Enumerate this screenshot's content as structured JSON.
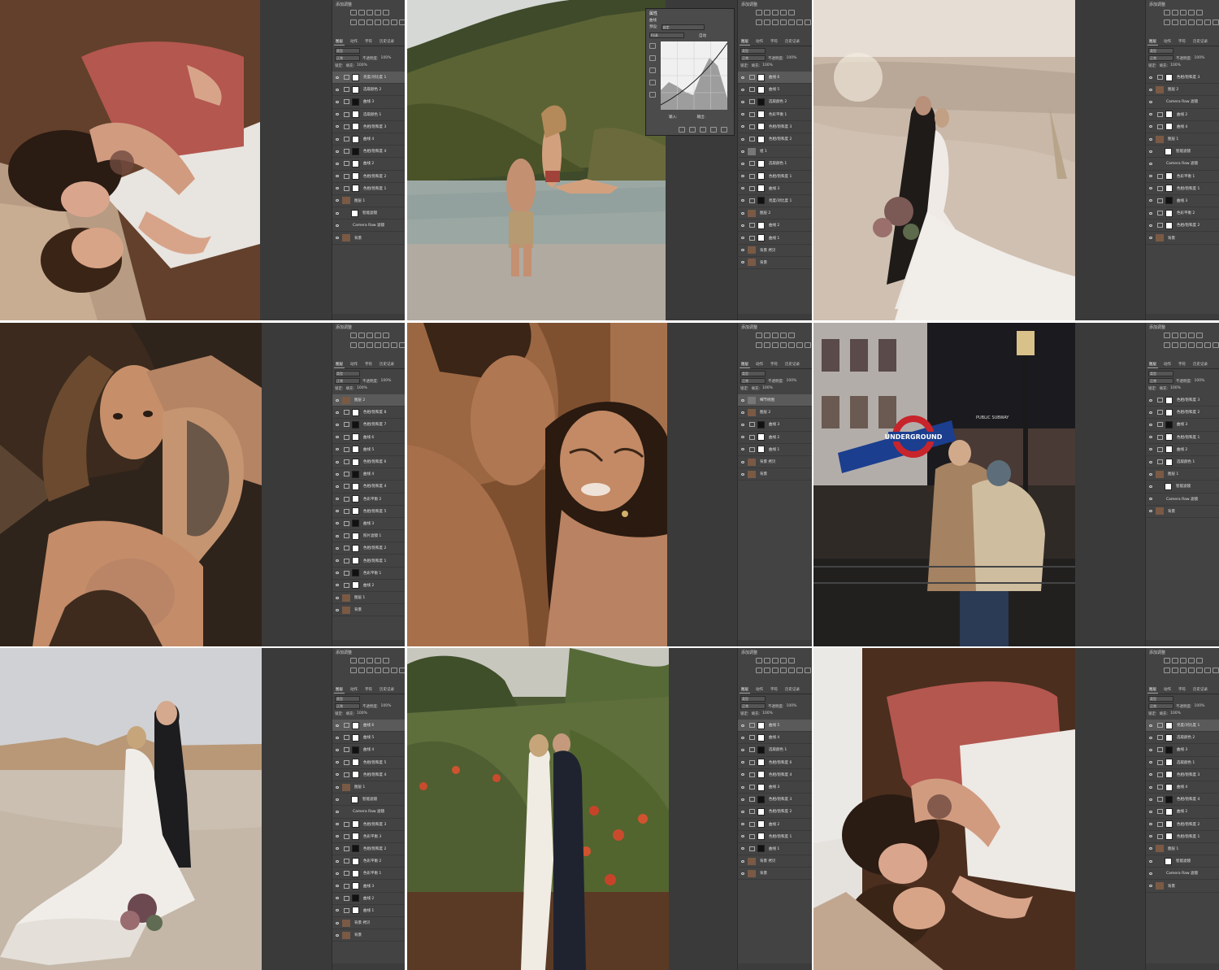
{
  "panels": {
    "adjust_title": "添加调整",
    "tabs": [
      "图层",
      "动作",
      "字符",
      "历史记录"
    ],
    "kind_label": "类型",
    "blend_mode": "正常",
    "opacity_label": "不透明度:",
    "opacity_value": "100%",
    "lock_label": "锁定:",
    "fill_label": "填充:",
    "fill_value": "100%"
  },
  "curves_dialog": {
    "title": "属性",
    "subtitle": "曲线",
    "preset_label": "预设:",
    "preset_value": "自定",
    "channel": "RGB",
    "auto_label": "自动",
    "input_label": "输入:",
    "output_label": "输出:"
  },
  "cells": [
    {
      "photo_alt": "couple-lying-wood-floor",
      "layers": [
        "亮度/对比度 1",
        "选取颜色 2",
        "曲线 3",
        "选取颜色 1",
        "色相/饱和度 3",
        "曲线 4",
        "色相/饱和度 4",
        "曲线 2",
        "色相/饱和度 2",
        "色相/饱和度 1",
        "图层 1",
        "智能滤镜",
        "Camera Raw 滤镜",
        "背景"
      ],
      "highlight": 0
    },
    {
      "photo_alt": "couple-beach-water",
      "layers": [
        "曲线 6",
        "曲线 5",
        "选取颜色 2",
        "色彩平衡 1",
        "色相/饱和度 3",
        "色相/饱和度 2",
        "组 1",
        "选取颜色 1",
        "色相/饱和度 1",
        "曲线 3",
        "亮度/对比度 1",
        "图层 2",
        "曲线 2",
        "曲线 1",
        "背景 拷贝",
        "背景"
      ],
      "highlight": 0
    },
    {
      "photo_alt": "couple-desert-wedding",
      "layers": [
        "色相/饱和度 3",
        "图层 2",
        "Camera Raw 滤镜",
        "曲线 2",
        "曲线 4",
        "图层 1",
        "智能滤镜",
        "Camera Raw 滤镜",
        "色彩平衡 1",
        "色相/饱和度 1",
        "曲线 3",
        "色彩平衡 2",
        "色相/饱和度 2",
        "背景"
      ],
      "highlight": -1
    },
    {
      "photo_alt": "couple-intimate-tattoo",
      "layers": [
        "图层 2",
        "色相/饱和度 8",
        "色相/饱和度 7",
        "曲线 6",
        "曲线 5",
        "色相/饱和度 6",
        "曲线 4",
        "色相/饱和度 4",
        "色彩平衡 2",
        "色相/饱和度 5",
        "曲线 3",
        "照片滤镜 1",
        "色相/饱和度 2",
        "色相/饱和度 1",
        "色彩平衡 1",
        "曲线 2",
        "图层 1",
        "背景"
      ],
      "highlight": 0
    },
    {
      "photo_alt": "couple-shower",
      "layers": [
        "细节修图",
        "图层 2",
        "曲线 3",
        "曲线 2",
        "曲线 1",
        "背景 拷贝",
        "背景"
      ],
      "highlight": 0
    },
    {
      "photo_alt": "couple-underground-london",
      "layers": [
        "色相/饱和度 3",
        "色相/饱和度 2",
        "曲线 3",
        "色相/饱和度 1",
        "曲线 2",
        "选取颜色 1",
        "图层 1",
        "智能滤镜",
        "Camera Raw 滤镜",
        "背景"
      ],
      "highlight": -1
    },
    {
      "photo_alt": "couple-beach-wedding-dress",
      "layers": [
        "曲线 6",
        "曲线 5",
        "曲线 4",
        "色相/饱和度 5",
        "色相/饱和度 4",
        "图层 1",
        "智能滤镜",
        "Camera Raw 滤镜",
        "色相/饱和度 3",
        "色彩平衡 3",
        "色相/饱和度 2",
        "色彩平衡 2",
        "色彩平衡 1",
        "曲线 3",
        "曲线 2",
        "曲线 1",
        "背景 拷贝",
        "背景"
      ],
      "highlight": 0
    },
    {
      "photo_alt": "couple-pomegranate-orchard",
      "layers": [
        "曲线 5",
        "曲线 4",
        "选取颜色 1",
        "色相/饱和度 6",
        "色相/饱和度 4",
        "曲线 3",
        "色相/饱和度 3",
        "色相/饱和度 2",
        "曲线 2",
        "色相/饱和度 1",
        "曲线 1",
        "背景 拷贝",
        "背景"
      ],
      "highlight": 0
    },
    {
      "photo_alt": "couple-lying-wood-floor-2",
      "layers": [
        "亮度/对比度 1",
        "选取颜色 2",
        "曲线 3",
        "选取颜色 1",
        "色相/饱和度 3",
        "曲线 4",
        "色相/饱和度 4",
        "曲线 2",
        "色相/饱和度 2",
        "色相/饱和度 1",
        "图层 1",
        "智能滤镜",
        "Camera Raw 滤镜",
        "背景"
      ],
      "highlight": 0
    }
  ],
  "sign_text": "UNDERGROUND",
  "sign_text2": "PUBLIC SUBWAY",
  "colors": {
    "panel_bg": "#434343",
    "workspace": "#3a3a3a",
    "sign_red": "#c8242b",
    "sign_blue": "#1b3e8f"
  }
}
